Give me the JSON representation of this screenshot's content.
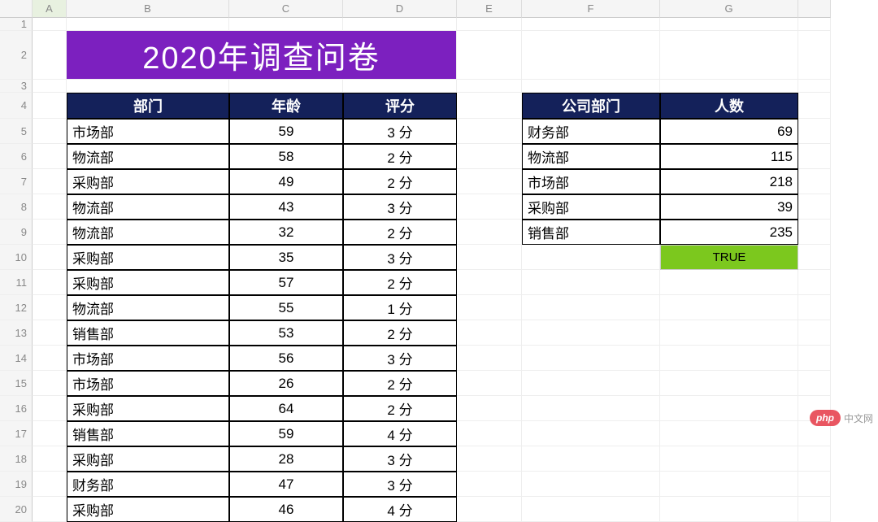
{
  "columns": [
    "",
    "A",
    "B",
    "C",
    "D",
    "E",
    "F",
    "G",
    ""
  ],
  "row_numbers": [
    "1",
    "2",
    "3",
    "4",
    "5",
    "6",
    "7",
    "8",
    "9",
    "10",
    "11",
    "12",
    "13",
    "14",
    "15",
    "16",
    "17",
    "18",
    "19",
    "20"
  ],
  "title": "2020年调查问卷",
  "main_table": {
    "headers": [
      "部门",
      "年龄",
      "评分"
    ],
    "rows": [
      {
        "dept": "市场部",
        "age": "59",
        "score": "3 分"
      },
      {
        "dept": "物流部",
        "age": "58",
        "score": "2 分"
      },
      {
        "dept": "采购部",
        "age": "49",
        "score": "2 分"
      },
      {
        "dept": "物流部",
        "age": "43",
        "score": "3 分"
      },
      {
        "dept": "物流部",
        "age": "32",
        "score": "2 分"
      },
      {
        "dept": "采购部",
        "age": "35",
        "score": "3 分"
      },
      {
        "dept": "采购部",
        "age": "57",
        "score": "2 分"
      },
      {
        "dept": "物流部",
        "age": "55",
        "score": "1 分"
      },
      {
        "dept": "销售部",
        "age": "53",
        "score": "2 分"
      },
      {
        "dept": "市场部",
        "age": "56",
        "score": "3 分"
      },
      {
        "dept": "市场部",
        "age": "26",
        "score": "2 分"
      },
      {
        "dept": "采购部",
        "age": "64",
        "score": "2 分"
      },
      {
        "dept": "销售部",
        "age": "59",
        "score": "4 分"
      },
      {
        "dept": "采购部",
        "age": "28",
        "score": "3 分"
      },
      {
        "dept": "财务部",
        "age": "47",
        "score": "3 分"
      },
      {
        "dept": "采购部",
        "age": "46",
        "score": "4 分"
      }
    ]
  },
  "side_table": {
    "headers": [
      "公司部门",
      "人数"
    ],
    "rows": [
      {
        "dept": "财务部",
        "count": "69"
      },
      {
        "dept": "物流部",
        "count": "115"
      },
      {
        "dept": "市场部",
        "count": "218"
      },
      {
        "dept": "采购部",
        "count": "39"
      },
      {
        "dept": "销售部",
        "count": "235"
      }
    ]
  },
  "true_value": "TRUE",
  "watermark": {
    "badge": "php",
    "text": "中文网"
  },
  "selected_column": "A"
}
